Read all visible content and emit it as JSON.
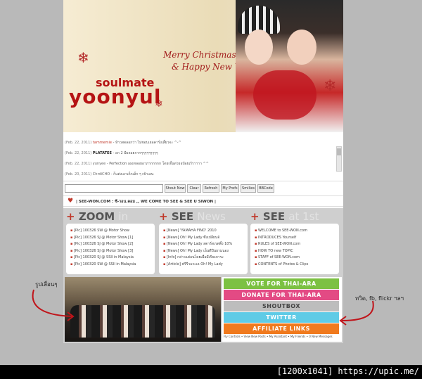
{
  "banner": {
    "greeting_line1": "Merry Christmas",
    "greeting_line2": "& Happy New Year",
    "logo_top": "soulmate",
    "logo_main": "yoonyul"
  },
  "chat": {
    "lines": [
      {
        "date": "(Feb. 22, 2011)",
        "nick": "tammemie",
        "text": "- ห้าวสดลอกว่า ไม่ชอบเธอคารั่งเลี้ยวจะ ^-^"
      },
      {
        "date": "(Feb. 22, 2011)",
        "nick": "PLATATEE",
        "text": "- อก 2 มีผลอยกากๆๆๆๆๆๆๆๆๆ"
      },
      {
        "date": "(Feb. 22, 2011)",
        "nick": "yunyee",
        "text": "- Perfection เออหลอยอาภากกกกก โดยเจิ้นด่วยอบ้อยเร้ราาาา ^^"
      },
      {
        "date": "(Feb. 20, 2011)",
        "nick": "ChrdiCHO",
        "text": "- ก็แต่งเอาเด็กเล็ก ๆ เข้าเอน"
      }
    ],
    "input_placeholder": "",
    "buttons": [
      "Shout Now",
      "Clear",
      "Refresh",
      "My Prefs",
      "Smilies",
      "BBCode"
    ]
  },
  "tagline": "| SEE-WON.COM : ซี-วอน.คอม ,, WE COME TO SEE & SEE U SIWON |",
  "columns": [
    {
      "plus": "+",
      "title": "ZOOM",
      "ghost": "in",
      "items": [
        "[Pic] 100326 SW @ Motor Show",
        "[Pic] 100326 SJ @ Motor Show [1]",
        "[Pic] 100326 SJ @ Motor Show [2]",
        "[Pic] 100326 SJ @ Motor Show [3]",
        "[Pic] 100320 SJ @ SSII in Malaysia",
        "[Pic] 100320 SW @ SSII in Malaysia"
      ]
    },
    {
      "plus": "+",
      "title": "SEE",
      "ghost": "News",
      "items": [
        "[News] 'YAMAHA FINO' 2010",
        "[News] Oh! My Lady ซึ่งเปลี่ยนจั",
        "[News] Oh! My Lady สตาร์ทเรตติ้ง 10%",
        "[News] Oh! My Lady เอ็นดีปีนยามนอง",
        "[Info] กล่าวแต่อนโดยเมื่อมีเรียงภาระ",
        "[Article] ฟรีรีวแระเล Oh! My Lady"
      ]
    },
    {
      "plus": "+",
      "title": "SEE",
      "ghost": "at 1st",
      "items": [
        "WELCOME to SEE-WON.com",
        "INTRODUCES Yourself",
        "RULES of SEE-WON.com",
        "HOW TO new TOPIC",
        "STAFF of SEE-WON.com",
        "CONTENTS of Photos & Clips"
      ]
    }
  ],
  "links": [
    {
      "label": "VOTE FOR THAI-ARA",
      "color": "#7cc142"
    },
    {
      "label": "DONATE FOR THAI-ARA",
      "color": "#e34a84"
    },
    {
      "label": "SHOUTBOX",
      "color": "#bdbdbd"
    },
    {
      "label": "TWITTER",
      "color": "#5fcbe6"
    },
    {
      "label": "AFFILIATE LINKS",
      "color": "#f07a1e"
    }
  ],
  "fly_controls": "Fly Controls • View New Posts • My Assistant • My Friends • 0 New Messages",
  "annotations": {
    "left": "รูปเลื่อนๆ",
    "right": "ทวิต, fb, flickr ฯลฯ"
  },
  "footer": "[1200x1041] https://upic.me/"
}
